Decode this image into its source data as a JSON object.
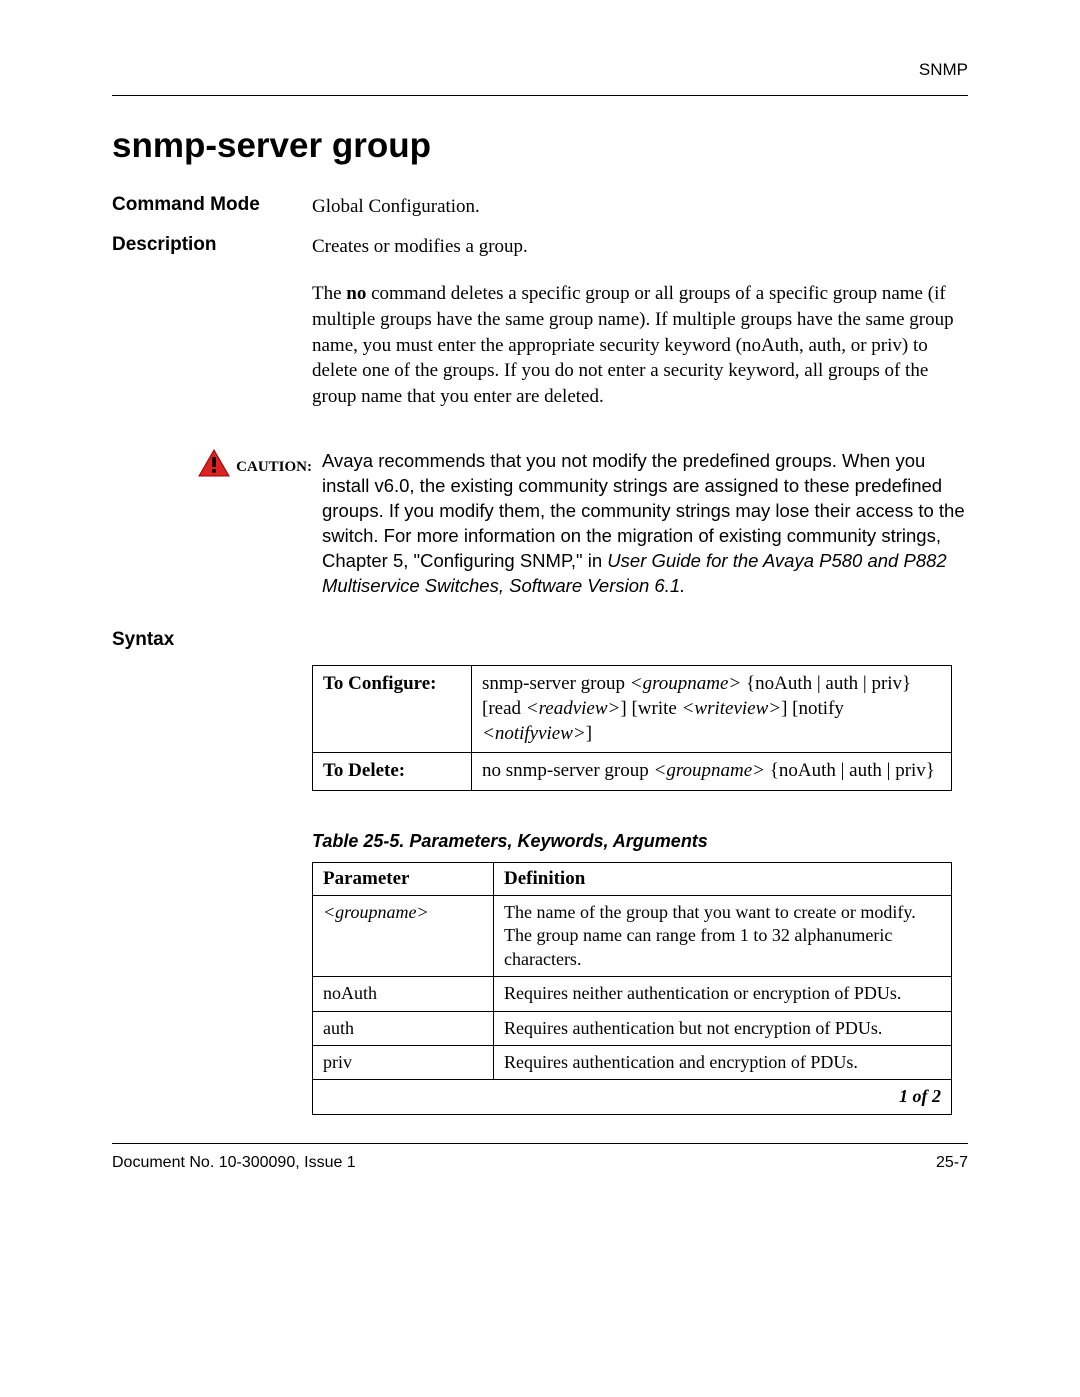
{
  "header": {
    "section": "SNMP"
  },
  "title": "snmp-server group",
  "rows": {
    "command_mode_label": "Command Mode",
    "command_mode_value": "Global Configuration.",
    "description_label": "Description",
    "description_value": "Creates or modifies a group.",
    "description_para_prefix": "The ",
    "description_para_bold": "no",
    "description_para_rest": " command deletes a specific group or all groups of a specific group name (if multiple groups have the same group name). If multiple groups have the same group name, you must enter the appropriate security keyword (noAuth, auth, or priv) to delete one of the groups. If you do not enter a security keyword, all groups of the group name that you enter are deleted.",
    "syntax_label": "Syntax"
  },
  "caution": {
    "label": "CAUTION:",
    "text_main": "Avaya recommends that you not modify the predefined groups. When you install v6.0, the existing community strings are assigned to these predefined groups. If you modify them, the community strings may lose their access to the switch. For more information on the migration of existing community strings, Chapter 5, \"Configuring SNMP,\" in ",
    "text_italic": "User Guide for the Avaya P580 and P882 Multiservice Switches, Software Version 6.1."
  },
  "syntax_table": {
    "configure_label": "To Configure:",
    "configure_cmd_prefix": "snmp-server group ",
    "configure_groupname": "<groupname>",
    "configure_rest1": " {noAuth | auth | priv} [read ",
    "configure_readview": "<readview>",
    "configure_rest2": "] [write ",
    "configure_writeview": "<writeview>",
    "configure_rest3": "] [notify ",
    "configure_notifyview": "<notifyview>",
    "configure_rest4": "]",
    "delete_label": "To Delete:",
    "delete_cmd_prefix": "no snmp-server group ",
    "delete_groupname": "<groupname>",
    "delete_rest": " {noAuth | auth | priv}"
  },
  "table_caption": "Table 25-5. Parameters, Keywords, Arguments",
  "param_table": {
    "header_param": "Parameter",
    "header_def": "Definition",
    "rows": [
      {
        "param": "<groupname>",
        "param_italic": true,
        "def": "The name of the group that you want to create or modify. The group name can range from 1 to 32 alphanumeric characters."
      },
      {
        "param": "noAuth",
        "param_italic": false,
        "def": "Requires neither authentication or encryption of PDUs."
      },
      {
        "param": "auth",
        "param_italic": false,
        "def": "Requires authentication but not encryption of PDUs."
      },
      {
        "param": "priv",
        "param_italic": false,
        "def": "Requires authentication and encryption of PDUs."
      }
    ],
    "pager": "1 of 2"
  },
  "footer": {
    "doc": "Document No. 10-300090, Issue 1",
    "page": "25-7"
  }
}
